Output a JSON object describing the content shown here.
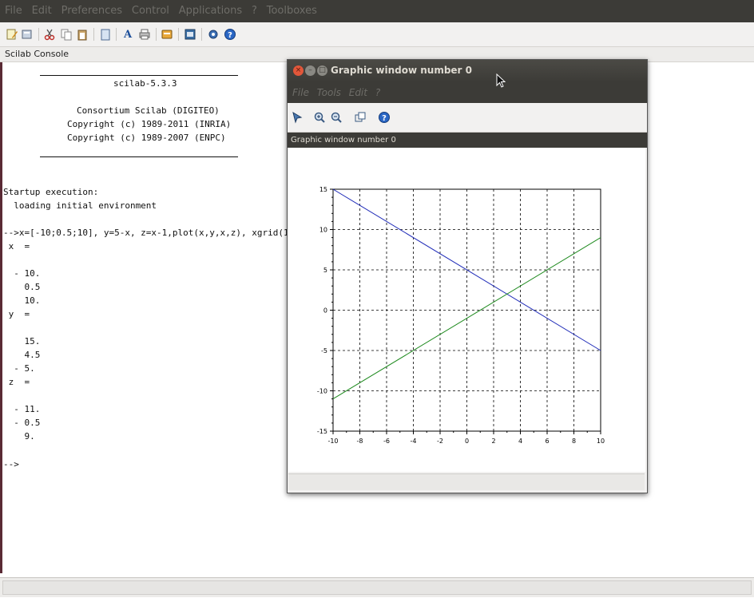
{
  "menubar": {
    "items": [
      "File",
      "Edit",
      "Preferences",
      "Control",
      "Applications",
      "?",
      "Toolboxes"
    ]
  },
  "toolbar": {
    "icons": [
      "new-script-icon",
      "open-file-icon",
      "cut-icon",
      "copy-icon",
      "paste-icon",
      "change-directory-icon",
      "font-icon",
      "print-icon",
      "module-manager-icon",
      "variable-browser-icon",
      "demos-icon",
      "help-icon"
    ]
  },
  "console_title": "Scilab Console",
  "console": {
    "banner": [
      "scilab-5.3.3",
      "Consortium Scilab (DIGITEO)",
      "Copyright (c) 1989-2011 (INRIA)",
      "Copyright (c) 1989-2007 (ENPC)"
    ],
    "lines": [
      "Startup execution:",
      "  loading initial environment",
      "-->x=[-10;0.5;10], y=5-x, z=x-1,plot(x,y,x,z), xgrid(1)",
      " x  =",
      "  - 10.",
      "    0.5",
      "    10.",
      " y  =",
      "    15.",
      "    4.5",
      "  - 5.",
      " z  =",
      "  - 11.",
      "  - 0.5",
      "    9.",
      "-->"
    ]
  },
  "graphic_window": {
    "title": "Graphic window number 0",
    "menu": [
      "File",
      "Tools",
      "Edit",
      "?"
    ],
    "label": "Graphic window number 0",
    "tools": [
      "select-icon",
      "zoom-in-icon",
      "zoom-out-icon",
      "rotate-icon",
      "help-icon"
    ]
  },
  "chart_data": {
    "type": "line",
    "title": "",
    "xlabel": "",
    "ylabel": "",
    "xlim": [
      -10,
      10
    ],
    "ylim": [
      -15,
      15
    ],
    "grid": true,
    "xticks": [
      "-10",
      "-8",
      "-6",
      "-4",
      "-2",
      "0",
      "2",
      "4",
      "6",
      "8",
      "10"
    ],
    "yticks": [
      "15",
      "10",
      "5",
      "0",
      "-5",
      "-10",
      "-15"
    ],
    "x": [
      -10,
      0.5,
      10
    ],
    "series": [
      {
        "values": [
          15,
          4.5,
          -5
        ],
        "color": "#1f2bb8"
      },
      {
        "values": [
          -11,
          -0.5,
          9
        ],
        "color": "#1e8a1e"
      }
    ]
  }
}
